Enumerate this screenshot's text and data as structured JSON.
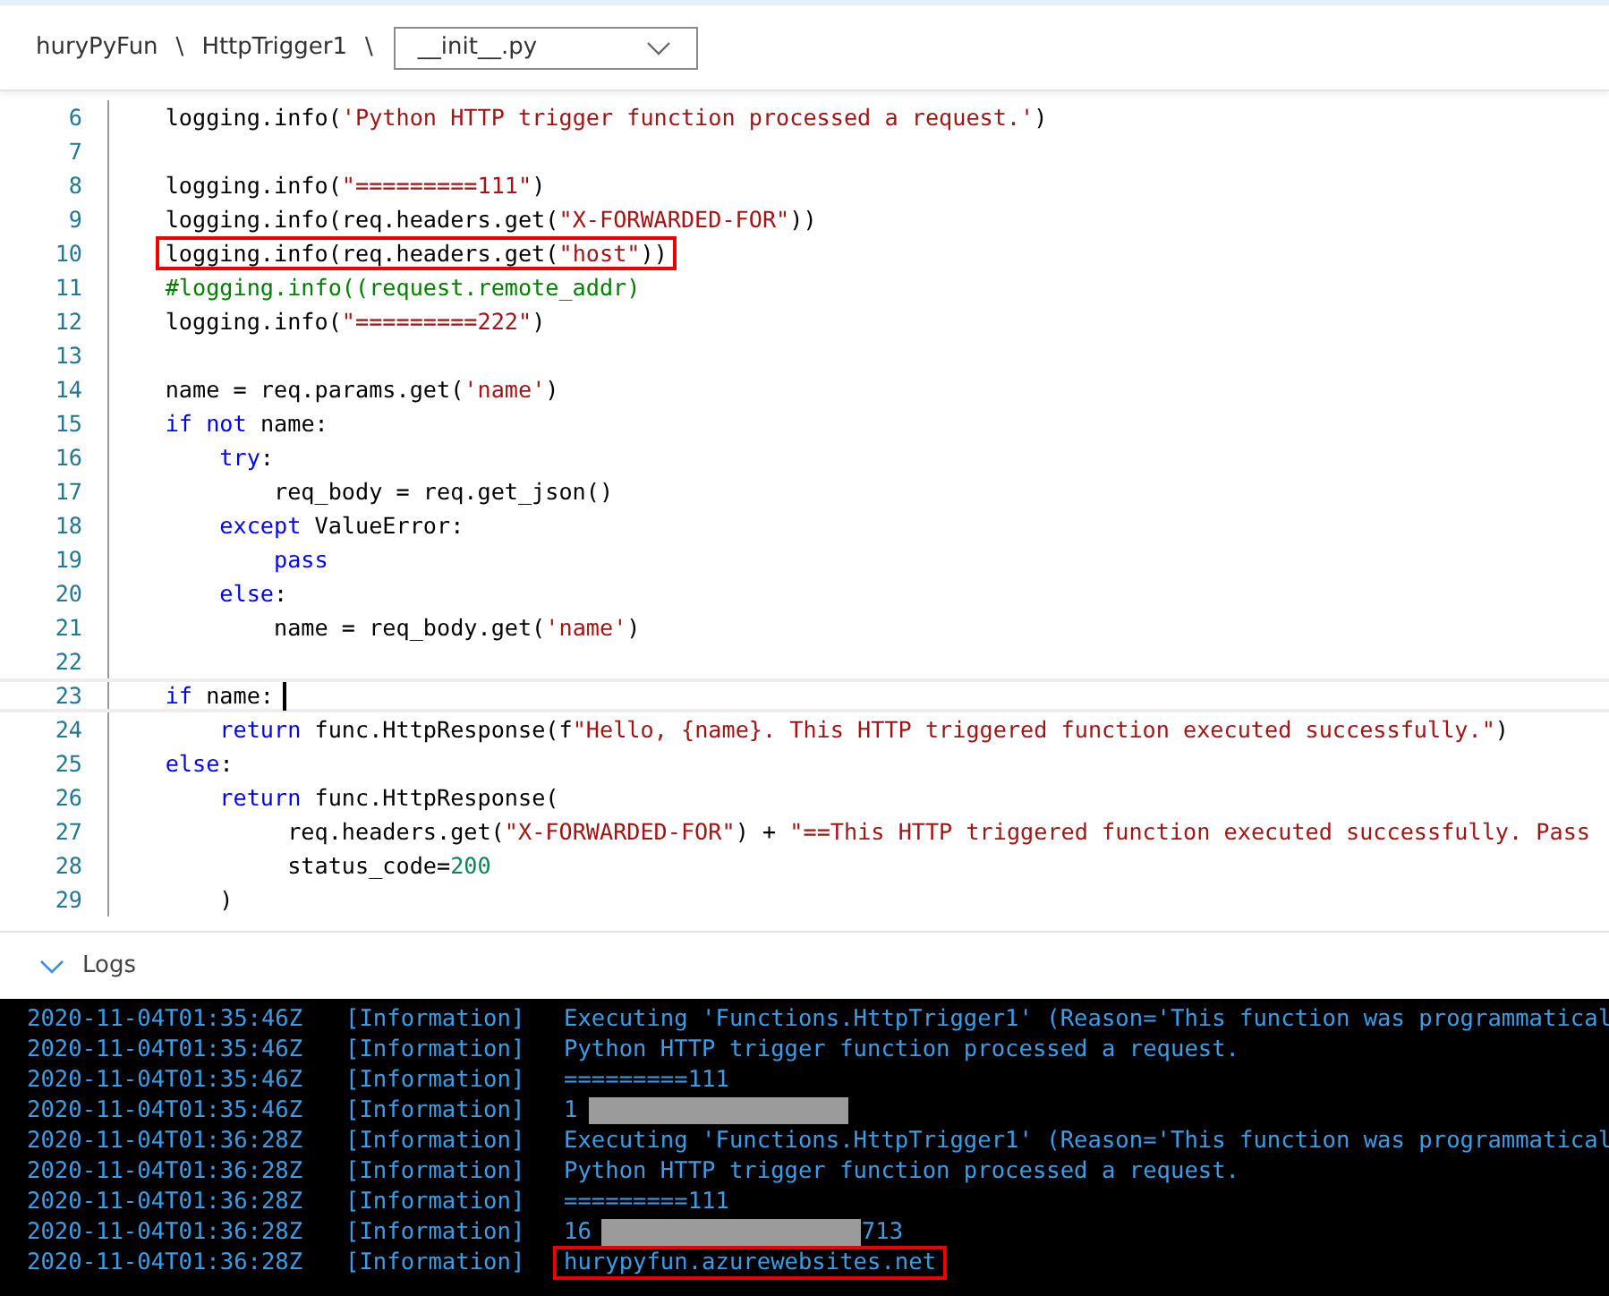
{
  "breadcrumb": {
    "items": [
      "huryPyFun",
      "HttpTrigger1"
    ],
    "separator": "\\",
    "file": "__init__.py"
  },
  "editor": {
    "lines": [
      {
        "number": "6",
        "highlighted": false,
        "cursor": false,
        "tokens": [
          {
            "kind": "plain",
            "text": "    logging.info("
          },
          {
            "kind": "string",
            "text": "'Python HTTP trigger function processed a request.'"
          },
          {
            "kind": "plain",
            "text": ")"
          }
        ]
      },
      {
        "number": "7",
        "cursor": false
      },
      {
        "number": "8",
        "highlighted": false,
        "cursor": false,
        "tokens": [
          {
            "kind": "plain",
            "text": "    logging.info("
          },
          {
            "kind": "string",
            "text": "\"=========111\""
          },
          {
            "kind": "plain",
            "text": ")"
          }
        ]
      },
      {
        "number": "9",
        "highlighted": false,
        "cursor": false,
        "tokens": [
          {
            "kind": "plain",
            "text": "    logging.info(req.headers.get("
          },
          {
            "kind": "string",
            "text": "\"X-FORWARDED-FOR\""
          },
          {
            "kind": "plain",
            "text": "))"
          }
        ]
      },
      {
        "number": "10",
        "highlighted": true,
        "cursor": false,
        "tokens": [
          {
            "kind": "plain",
            "text": "    logging.info(req.headers.get("
          },
          {
            "kind": "string",
            "text": "\"host\""
          },
          {
            "kind": "plain",
            "text": "))"
          }
        ]
      },
      {
        "number": "11",
        "highlighted": false,
        "cursor": false,
        "tokens": [
          {
            "kind": "comment",
            "text": "    #logging.info((request.remote_addr)"
          }
        ]
      },
      {
        "number": "12",
        "highlighted": false,
        "cursor": false,
        "tokens": [
          {
            "kind": "plain",
            "text": "    logging.info("
          },
          {
            "kind": "string",
            "text": "\"=========222\""
          },
          {
            "kind": "plain",
            "text": ")"
          }
        ]
      },
      {
        "number": "13",
        "cursor": false
      },
      {
        "number": "14",
        "highlighted": false,
        "cursor": false,
        "tokens": [
          {
            "kind": "plain",
            "text": "    name = req.params.get("
          },
          {
            "kind": "string",
            "text": "'name'"
          },
          {
            "kind": "plain",
            "text": ")"
          }
        ]
      },
      {
        "number": "15",
        "highlighted": false,
        "cursor": false,
        "tokens": [
          {
            "kind": "keyword",
            "text": "    if"
          },
          {
            "kind": "keyword",
            "text": " not"
          },
          {
            "kind": "plain",
            "text": " name:"
          }
        ]
      },
      {
        "number": "16",
        "highlighted": false,
        "cursor": false,
        "tokens": [
          {
            "kind": "keyword",
            "text": "        try"
          },
          {
            "kind": "plain",
            "text": ":"
          }
        ]
      },
      {
        "number": "17",
        "highlighted": false,
        "cursor": false,
        "tokens": [
          {
            "kind": "plain",
            "text": "            req_body = req.get_json()"
          }
        ]
      },
      {
        "number": "18",
        "highlighted": false,
        "cursor": false,
        "tokens": [
          {
            "kind": "keyword",
            "text": "        except"
          },
          {
            "kind": "plain",
            "text": " ValueError:"
          }
        ]
      },
      {
        "number": "19",
        "highlighted": false,
        "cursor": false,
        "tokens": [
          {
            "kind": "keyword",
            "text": "            pass"
          }
        ]
      },
      {
        "number": "20",
        "highlighted": false,
        "cursor": false,
        "tokens": [
          {
            "kind": "keyword",
            "text": "        else"
          },
          {
            "kind": "plain",
            "text": ":"
          }
        ]
      },
      {
        "number": "21",
        "highlighted": false,
        "cursor": false,
        "tokens": [
          {
            "kind": "plain",
            "text": "            name = req_body.get("
          },
          {
            "kind": "string",
            "text": "'name'"
          },
          {
            "kind": "plain",
            "text": ")"
          }
        ]
      },
      {
        "number": "22",
        "cursor": false
      },
      {
        "number": "23",
        "highlighted": false,
        "cursor": true,
        "tokens": [
          {
            "kind": "keyword",
            "text": "    if"
          },
          {
            "kind": "plain",
            "text": " name:"
          }
        ]
      },
      {
        "number": "24",
        "highlighted": false,
        "cursor": false,
        "tokens": [
          {
            "kind": "keyword",
            "text": "        return"
          },
          {
            "kind": "plain",
            "text": " func.HttpResponse(f"
          },
          {
            "kind": "string",
            "text": "\"Hello, {name}. This HTTP triggered function executed successfully.\""
          },
          {
            "kind": "plain",
            "text": ")"
          }
        ]
      },
      {
        "number": "25",
        "highlighted": false,
        "cursor": false,
        "tokens": [
          {
            "kind": "keyword",
            "text": "    else"
          },
          {
            "kind": "plain",
            "text": ":"
          }
        ]
      },
      {
        "number": "26",
        "highlighted": false,
        "cursor": false,
        "tokens": [
          {
            "kind": "keyword",
            "text": "        return"
          },
          {
            "kind": "plain",
            "text": " func.HttpResponse("
          }
        ]
      },
      {
        "number": "27",
        "highlighted": false,
        "cursor": false,
        "tokens": [
          {
            "kind": "plain",
            "text": "             req.headers.get("
          },
          {
            "kind": "string",
            "text": "\"X-FORWARDED-FOR\""
          },
          {
            "kind": "plain",
            "text": ") + "
          },
          {
            "kind": "string",
            "text": "\"==This HTTP triggered function executed successfully. Pass"
          }
        ]
      },
      {
        "number": "28",
        "highlighted": false,
        "cursor": false,
        "tokens": [
          {
            "kind": "plain",
            "text": "             status_code="
          },
          {
            "kind": "number",
            "text": "200"
          }
        ]
      },
      {
        "number": "29",
        "highlighted": false,
        "cursor": false,
        "tokens": [
          {
            "kind": "plain",
            "text": "        )"
          }
        ]
      }
    ]
  },
  "logs": {
    "title": "Logs",
    "expanded": true,
    "entries": [
      {
        "timestamp": "2020-11-04T01:35:46Z",
        "level": "[Information]",
        "message": "Executing 'Functions.HttpTrigger1' (Reason='This function was programmatical",
        "redacted": false,
        "highlighted": false
      },
      {
        "timestamp": "2020-11-04T01:35:46Z",
        "level": "[Information]",
        "message": "Python HTTP trigger function processed a request.",
        "redacted": false,
        "highlighted": false
      },
      {
        "timestamp": "2020-11-04T01:35:46Z",
        "level": "[Information]",
        "message": "=========111",
        "redacted": false,
        "highlighted": false
      },
      {
        "timestamp": "2020-11-04T01:35:46Z",
        "level": "[Information]",
        "message": "1",
        "redacted": true,
        "highlighted": false
      },
      {
        "timestamp": "2020-11-04T01:36:28Z",
        "level": "[Information]",
        "message": "Executing 'Functions.HttpTrigger1' (Reason='This function was programmatical",
        "redacted": false,
        "highlighted": false
      },
      {
        "timestamp": "2020-11-04T01:36:28Z",
        "level": "[Information]",
        "message": "Python HTTP trigger function processed a request.",
        "redacted": false,
        "highlighted": false
      },
      {
        "timestamp": "2020-11-04T01:36:28Z",
        "level": "[Information]",
        "message": "=========111",
        "redacted": false,
        "highlighted": false
      },
      {
        "timestamp": "2020-11-04T01:36:28Z",
        "level": "[Information]",
        "message": "16",
        "redacted": true,
        "message_after": "713",
        "highlighted": false
      },
      {
        "timestamp": "2020-11-04T01:36:28Z",
        "level": "[Information]",
        "message": "hurypyfun.azurewebsites.net",
        "redacted": false,
        "highlighted": true
      }
    ]
  }
}
